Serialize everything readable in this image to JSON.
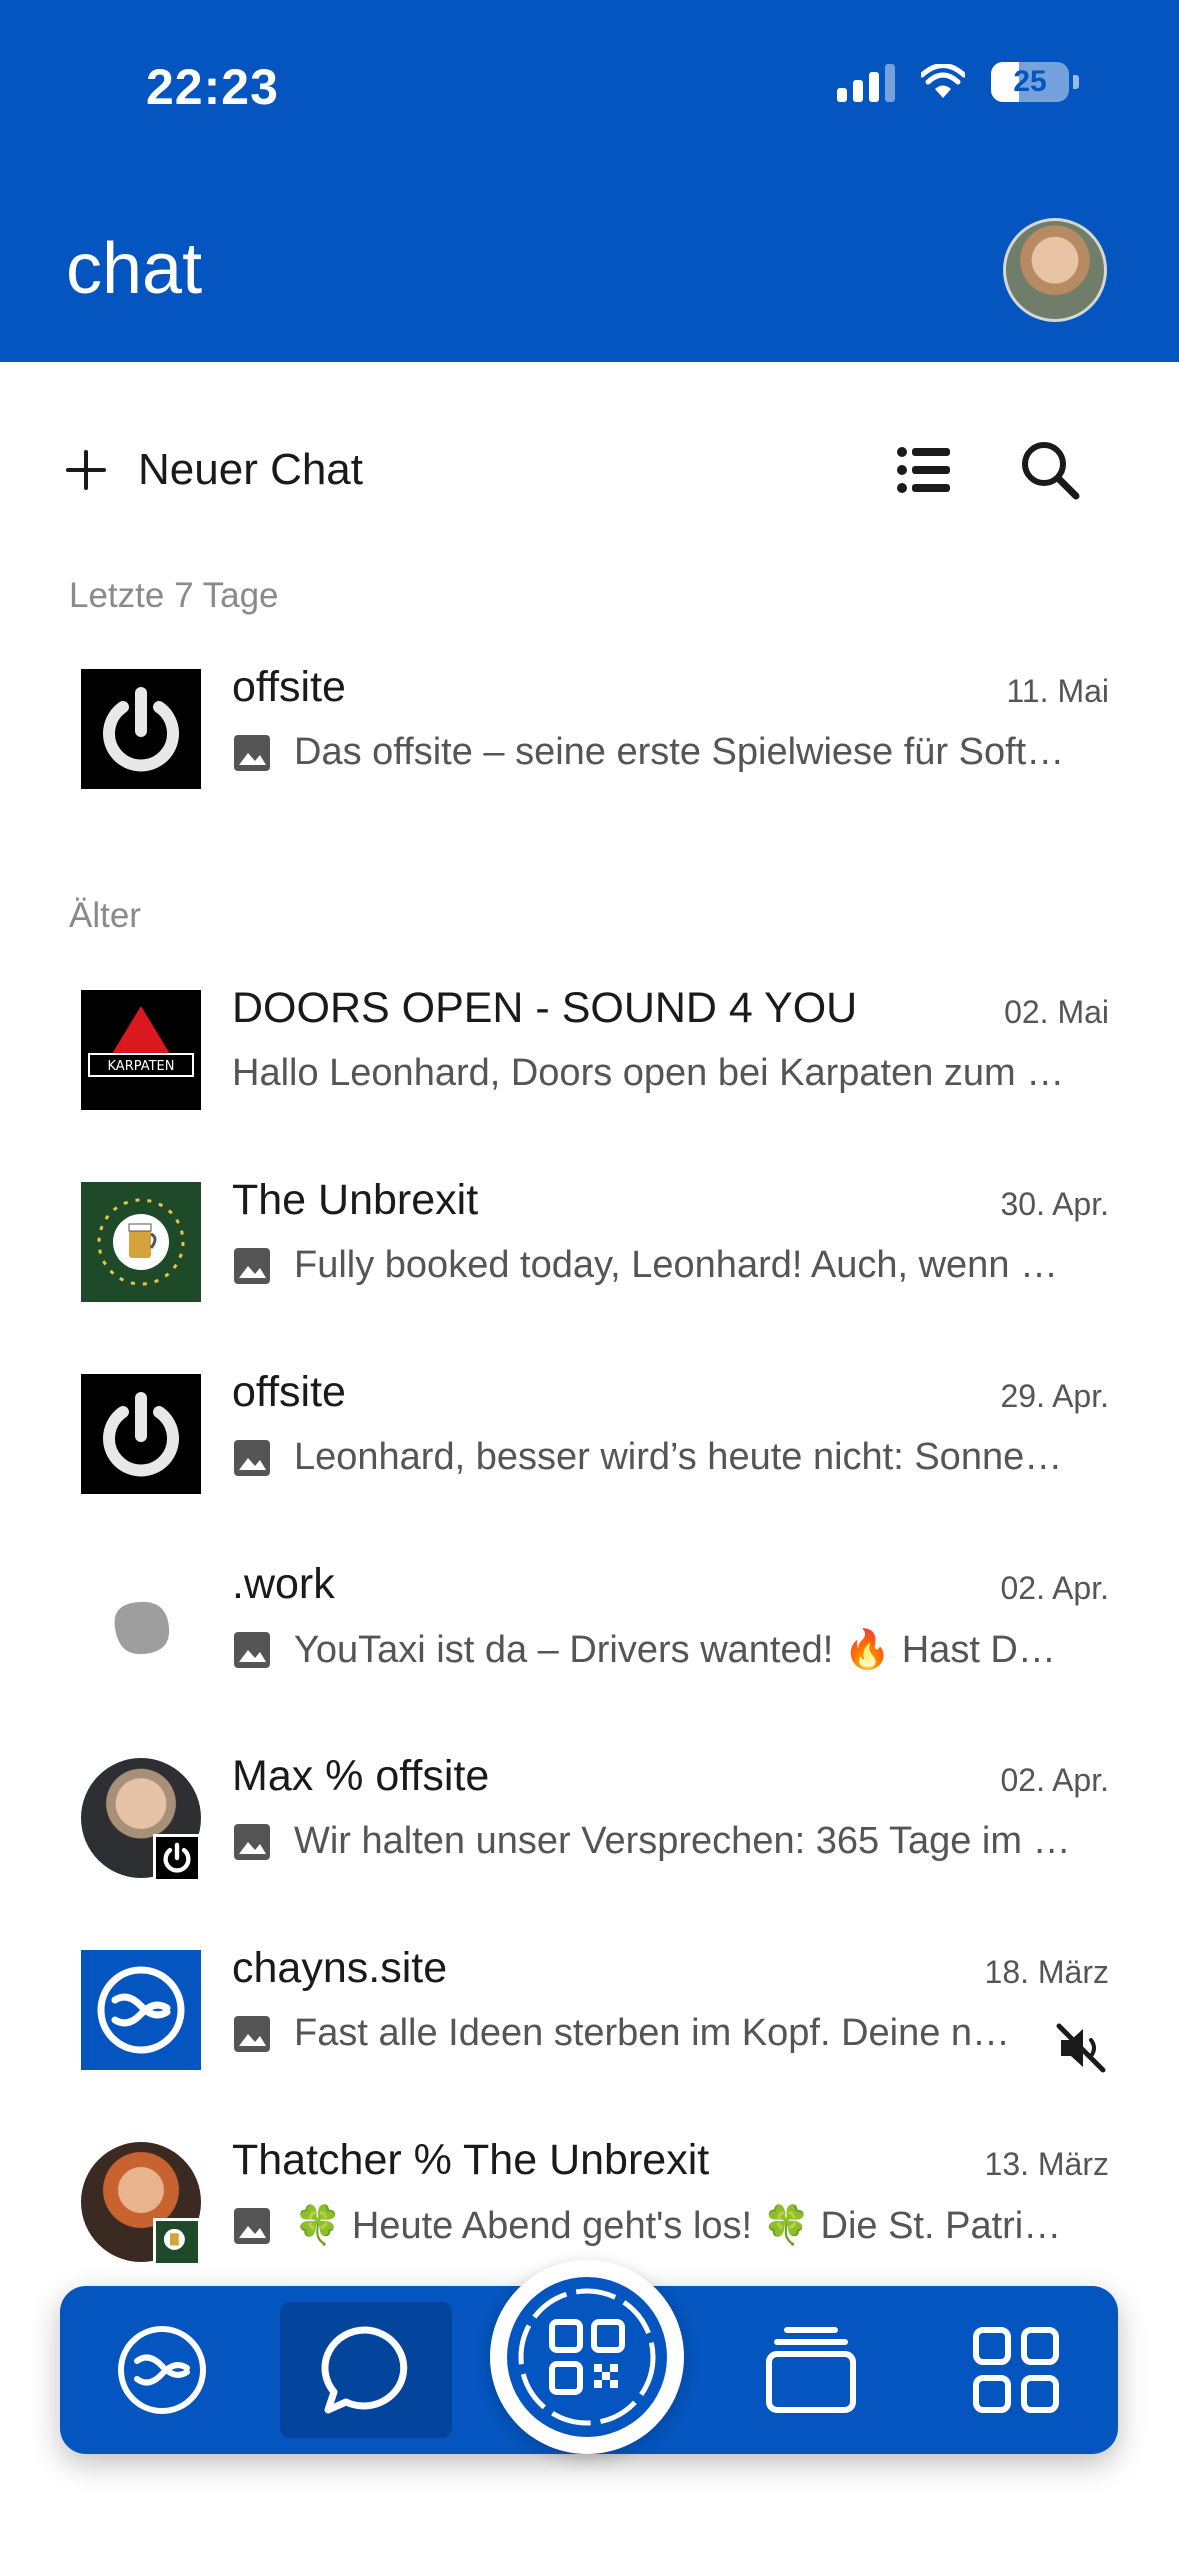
{
  "status_bar": {
    "time": "22:23",
    "battery": "25"
  },
  "header": {
    "title": "chat",
    "profile_avatar": "user-avatar"
  },
  "toolbar": {
    "new_chat_label": "Neuer Chat",
    "list_icon": "list-icon",
    "search_icon": "search-icon"
  },
  "sections": [
    {
      "label": "Letzte 7 Tage"
    },
    {
      "label": "Älter"
    }
  ],
  "chats": [
    {
      "title": "offsite",
      "date": "11. Mai",
      "preview": "Das offsite – seine erste Spielwiese für Soft…",
      "has_image": true,
      "avatar": "offsite-power-logo"
    },
    {
      "title": "DOORS OPEN - SOUND 4 YOU",
      "date": "02. Mai",
      "preview": "Hallo Leonhard, Doors open bei Karpaten zum S…",
      "has_image": false,
      "avatar": "karpaten-logo"
    },
    {
      "title": "The Unbrexit",
      "date": "30. Apr.",
      "preview": "Fully booked today, Leonhard! Auch, wenn e…",
      "has_image": true,
      "avatar": "unbrexit-logo"
    },
    {
      "title": "offsite",
      "date": "29. Apr.",
      "preview": "Leonhard, besser wird’s heute nicht: Sonne, …",
      "has_image": true,
      "avatar": "offsite-power-logo"
    },
    {
      "title": ".work",
      "date": "02. Apr.",
      "preview": "YouTaxi ist da – Drivers wanted! 🔥 Hast Du…",
      "has_image": true,
      "avatar": "work-blob"
    },
    {
      "title": "Max % offsite",
      "date": "02. Apr.",
      "preview": "Wir halten unser Versprechen: 365 Tage im …",
      "has_image": true,
      "avatar": "person-photo-with-offsite-badge"
    },
    {
      "title": "chayns.site",
      "date": "18. März",
      "preview": "Fast alle Ideen sterben im Kopf. Deine nic…",
      "has_image": true,
      "muted": true,
      "avatar": "chayns-logo"
    },
    {
      "title": "Thatcher % The Unbrexit",
      "date": "13. März",
      "preview": "🍀 Heute Abend geht's los! 🍀 Die St. Patric…",
      "has_image": true,
      "avatar": "person-photo-with-unbrexit-badge"
    }
  ],
  "bottom_nav": [
    {
      "name": "chayns-icon",
      "active": false
    },
    {
      "name": "chat-bubble-icon",
      "active": true
    },
    {
      "name": "qr-code-icon",
      "active": false
    },
    {
      "name": "cards-stack-icon",
      "active": false
    },
    {
      "name": "apps-grid-icon",
      "active": false
    }
  ],
  "colors": {
    "brand_blue": "#0455bf",
    "active_tab": "#03459c",
    "muted_text": "#8a8a8a"
  }
}
